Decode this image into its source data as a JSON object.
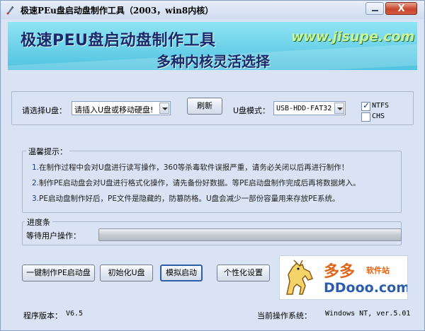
{
  "window": {
    "title": "极速PEu盘启动盘制作工具（2003，win8内核）",
    "close_label": "X"
  },
  "banner": {
    "title": "极速PEU盘启动盘制作工具",
    "site": "www.jisupe.com",
    "subtitle": "多种内核灵活选择"
  },
  "usb_select": {
    "label": "请选择U盘：",
    "value": "请插入U盘或移动硬盘!",
    "refresh_label": "刷新",
    "mode_label": "U盘模式：",
    "mode_value": "USB-HDD-FAT32",
    "ntfs_label": "NTFS",
    "ntfs_checked": true,
    "chs_label": "CHS",
    "chs_checked": false
  },
  "tips": {
    "title": "温馨提示：",
    "items": [
      {
        "num": "1.",
        "text": "在制作过程中会对U盘进行读写操作，360等杀毒软件误报严重，请务必关闭以后再进行制作！"
      },
      {
        "num": "2.",
        "text": "制作PE启动盘会对U盘进行格式化操作，请先备份好数据。等PE启动盘制作完成后再将数据烤入。"
      },
      {
        "num": "3.",
        "text": "PE启动盘制作好后，PE文件是隐藏的，防篡防格。U盘会减少一部份容量用来存放PE系统。"
      }
    ]
  },
  "progress": {
    "title": "进度条",
    "status_label": "等待用户操作：",
    "value": 0
  },
  "actions": {
    "make_label": "一键制作PE启动盘",
    "init_label": "初始化U盘",
    "simulate_label": "模拟启动",
    "custom_label": "个性化设置"
  },
  "logo": {
    "cn": "多多",
    "tag": "软件站",
    "en": "DDooo.com"
  },
  "footer": {
    "version_label": "程序版本：",
    "version": "V6.5",
    "os_label": "当前操作系统：",
    "os_value": "Windows NT, ver.5.01"
  }
}
